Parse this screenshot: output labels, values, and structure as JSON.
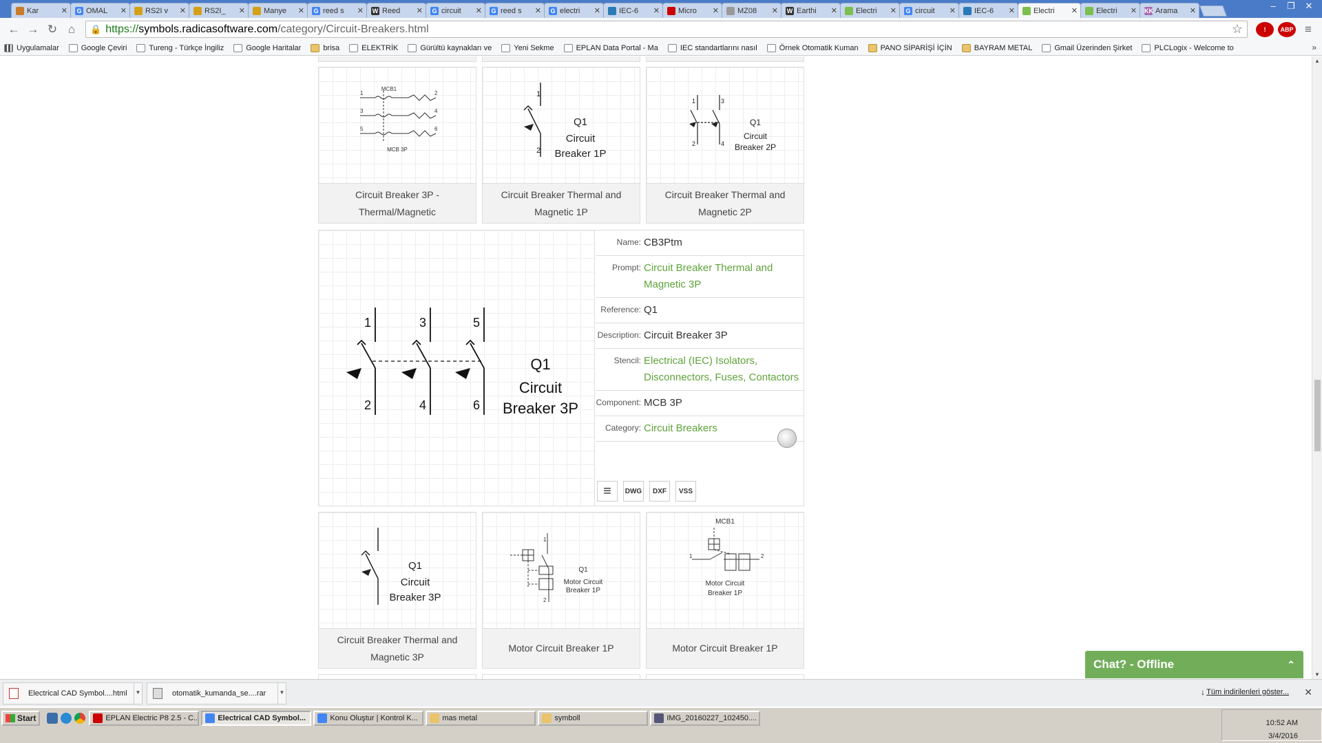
{
  "tabs": [
    {
      "label": "Kar",
      "color": "#c97a2b"
    },
    {
      "label": "OMAL",
      "color": "#4285f4",
      "icon": "G"
    },
    {
      "label": "RS2I v",
      "color": "#d4a017"
    },
    {
      "label": "RS2I_",
      "color": "#d4a017"
    },
    {
      "label": "Manye",
      "color": "#d4a017"
    },
    {
      "label": "reed s",
      "color": "#4285f4",
      "icon": "G"
    },
    {
      "label": "Reed",
      "color": "#333",
      "icon": "W"
    },
    {
      "label": "circuit",
      "color": "#4285f4",
      "icon": "G"
    },
    {
      "label": "reed s",
      "color": "#4285f4",
      "icon": "G"
    },
    {
      "label": "electri",
      "color": "#4285f4",
      "icon": "G"
    },
    {
      "label": "IEC-6",
      "color": "#2a7ab8"
    },
    {
      "label": "Micro",
      "color": "#c00"
    },
    {
      "label": "MZ08",
      "color": "#999"
    },
    {
      "label": "Earthi",
      "color": "#333",
      "icon": "W"
    },
    {
      "label": "Electri",
      "color": "#7bbf4e"
    },
    {
      "label": "circuit",
      "color": "#4285f4",
      "icon": "G"
    },
    {
      "label": "IEC-6",
      "color": "#2a7ab8"
    },
    {
      "label": "Electri",
      "color": "#7bbf4e",
      "active": true
    },
    {
      "label": "Electri",
      "color": "#7bbf4e"
    },
    {
      "label": "Arama",
      "color": "#a76bb0",
      "icon": "KK"
    }
  ],
  "address": {
    "scheme": "https://",
    "host": "symbols.radicasoftware.com",
    "path": "/category/Circuit-Breakers.html"
  },
  "extensions": [
    {
      "label": "!",
      "color": "#c00"
    },
    {
      "label": "ABP",
      "color": "#c00"
    }
  ],
  "bookmarks": [
    {
      "label": "Uygulamalar",
      "kind": "apps"
    },
    {
      "label": "Google Çeviri",
      "kind": "page"
    },
    {
      "label": "Tureng - Türkçe İngiliz",
      "kind": "page"
    },
    {
      "label": "Google Haritalar",
      "kind": "page"
    },
    {
      "label": "brisa",
      "kind": "folder"
    },
    {
      "label": "ELEKTRİK",
      "kind": "page"
    },
    {
      "label": "Gürültü kaynakları ve",
      "kind": "page"
    },
    {
      "label": "Yeni Sekme",
      "kind": "page"
    },
    {
      "label": "EPLAN Data Portal - Ma",
      "kind": "page"
    },
    {
      "label": "IEC standartlarını nasıl",
      "kind": "page"
    },
    {
      "label": "Örnek Otomatik Kuman",
      "kind": "page"
    },
    {
      "label": "PANO SİPARİŞİ İÇİN",
      "kind": "folder"
    },
    {
      "label": "BAYRAM METAL",
      "kind": "folder"
    },
    {
      "label": "Gmail Üzerinden Şirket",
      "kind": "page"
    },
    {
      "label": "PLCLogix - Welcome to",
      "kind": "page"
    }
  ],
  "cards_top": [
    {
      "caption": "Circuit Breaker 3P - Thermal/Magnetic",
      "diagram": {
        "title": "MCB1",
        "footer": "MCB 3P",
        "pins": [
          "1",
          "2",
          "3",
          "4",
          "5",
          "6"
        ]
      }
    },
    {
      "caption": "Circuit Breaker Thermal and Magnetic 1P",
      "diagram": {
        "ref": "Q1",
        "line1": "Circuit",
        "line2": "Breaker 1P",
        "pins": [
          "1",
          "2"
        ]
      }
    },
    {
      "caption": "Circuit Breaker Thermal and Magnetic 2P",
      "diagram": {
        "ref": "Q1",
        "line1": "Circuit",
        "line2": "Breaker 2P",
        "pins": [
          "1",
          "3",
          "2",
          "4"
        ]
      }
    }
  ],
  "detail": {
    "diagram": {
      "ref": "Q1",
      "line1": "Circuit",
      "line2": "Breaker 3P",
      "pins": [
        "1",
        "3",
        "5",
        "2",
        "4",
        "6"
      ]
    },
    "props": [
      {
        "key": "Name:",
        "value": "CB3Ptm",
        "link": false
      },
      {
        "key": "Prompt:",
        "value": "Circuit Breaker Thermal and Magnetic 3P",
        "link": true
      },
      {
        "key": "Reference:",
        "value": "Q1",
        "link": false
      },
      {
        "key": "Description:",
        "value": "Circuit Breaker 3P",
        "link": false
      },
      {
        "key": "Stencil:",
        "value": "Electrical (IEC) Isolators, Disconnectors, Fuses, Contactors",
        "link": true
      },
      {
        "key": "Component:",
        "value": "MCB 3P",
        "link": false
      },
      {
        "key": "Category:",
        "value": "Circuit Breakers",
        "link": true
      }
    ],
    "downloads": [
      "menu",
      "DWG",
      "DXF",
      "VSS"
    ]
  },
  "cards_bottom": [
    {
      "caption": "Circuit Breaker Thermal and Magnetic 3P",
      "diagram": {
        "ref": "Q1",
        "line1": "Circuit",
        "line2": "Breaker 3P"
      }
    },
    {
      "caption": "Motor Circuit Breaker 1P",
      "diagram": {
        "ref": "Q1",
        "line1": "Motor Circuit",
        "line2": "Breaker 1P",
        "pins": [
          "1",
          "2"
        ]
      }
    },
    {
      "caption": "Motor Circuit Breaker 1P",
      "diagram": {
        "title": "MCB1",
        "line1": "Motor Circuit",
        "line2": "Breaker 1P",
        "pins": [
          "1",
          "2"
        ]
      }
    }
  ],
  "chat": {
    "label": "Chat? - Offline"
  },
  "downloads_shelf": {
    "items": [
      {
        "label": "Electrical CAD Symbol....html",
        "icon": "pdf-icon"
      },
      {
        "label": "otomatik_kumanda_se....rar",
        "icon": "archive-icon"
      }
    ],
    "show_all": "Tüm indirilenleri göster..."
  },
  "taskbar": {
    "start": "Start",
    "items": [
      {
        "label": "EPLAN Electric P8 2.5 - C...",
        "color": "#c00",
        "active": false
      },
      {
        "label": "Electrical CAD Symbol...",
        "color": "#4285f4",
        "active": true
      },
      {
        "label": "Konu Oluştur | Kontrol K...",
        "color": "#4285f4",
        "active": false
      },
      {
        "label": "mas metal",
        "color": "#e9c46a",
        "active": false
      },
      {
        "label": "symboll",
        "color": "#e9c46a",
        "active": false
      },
      {
        "label": "IMG_20160227_102450....",
        "color": "#557",
        "active": false
      }
    ],
    "time": "10:52 AM",
    "date": "3/4/2016"
  }
}
